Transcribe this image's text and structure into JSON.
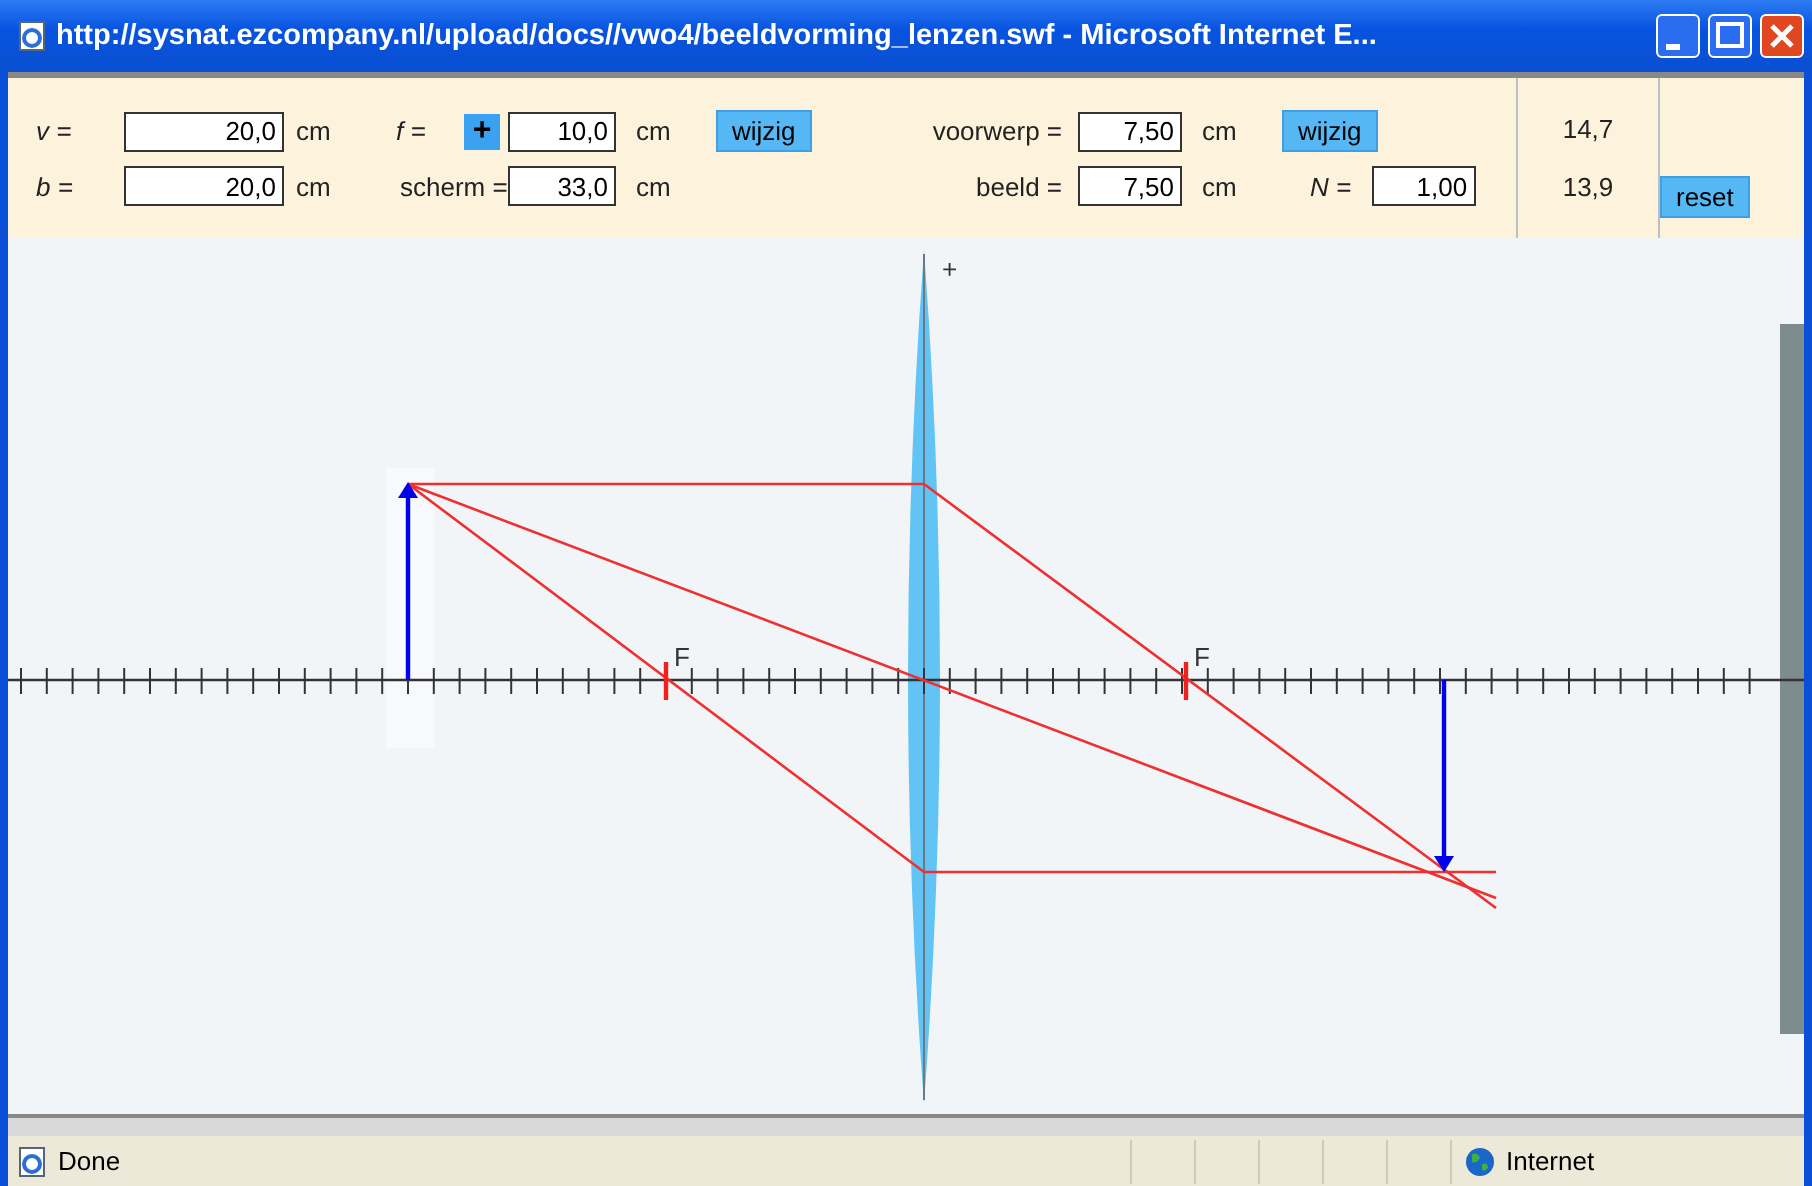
{
  "window": {
    "title": "http://sysnat.ezcompany.nl/upload/docs//vwo4/beeldvorming_lenzen.swf - Microsoft Internet E..."
  },
  "panel": {
    "object_distance": {
      "label": "v =",
      "value": "20,0",
      "unit": "cm"
    },
    "image_distance": {
      "label": "b =",
      "value": "20,0",
      "unit": "cm"
    },
    "focal": {
      "label": "f =",
      "sign": "+",
      "value": "10,0",
      "unit": "cm",
      "button": "wijzig"
    },
    "screen": {
      "label": "scherm =",
      "value": "33,0",
      "unit": "cm"
    },
    "object_size": {
      "label": "voorwerp =",
      "value": "7,50",
      "unit": "cm",
      "button": "wijzig"
    },
    "image_size": {
      "label": "beeld =",
      "value": "7,50",
      "unit": "cm"
    },
    "magnification": {
      "label": "N =",
      "value": "1,00"
    },
    "readouts": [
      "14,7",
      "13,9"
    ],
    "reset": "reset"
  },
  "diagram": {
    "lens_sign": "+",
    "focal_labels": [
      "F",
      "F"
    ]
  },
  "status_bar": {
    "text": "Done",
    "zone": "Internet"
  }
}
